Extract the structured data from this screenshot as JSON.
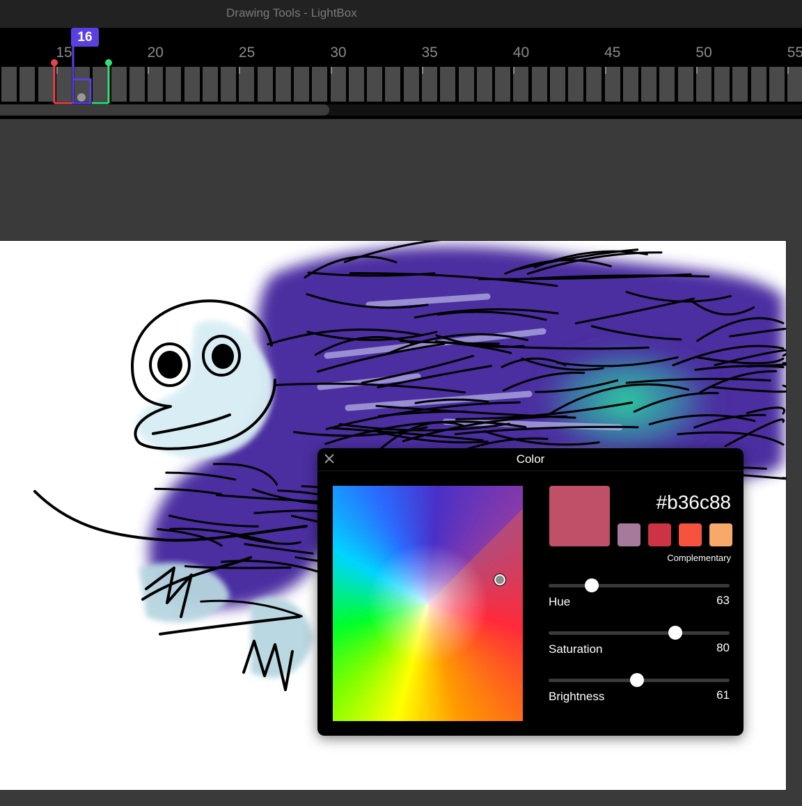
{
  "window": {
    "title": "Drawing Tools - LightBox"
  },
  "timeline": {
    "ruler_labels": [
      "15",
      "20",
      "25",
      "30",
      "35",
      "40",
      "45",
      "50",
      "55"
    ],
    "current_frame": "16",
    "colors": {
      "in_marker": "#e8434a",
      "out_marker": "#2fe07a",
      "playhead": "#5b3fe0"
    }
  },
  "color_panel": {
    "title": "Color",
    "hex_value": "#b36c88",
    "current_color": "#c05068",
    "palette": [
      "#a57a9a",
      "#cc3344",
      "#f5523f",
      "#f7a96a"
    ],
    "palette_caption": "Complementary",
    "sliders": [
      {
        "label": "Hue",
        "value": "63",
        "level": 0.24
      },
      {
        "label": "Saturation",
        "value": "80",
        "level": 0.7
      },
      {
        "label": "Brightness",
        "value": "61",
        "level": 0.49
      }
    ]
  }
}
